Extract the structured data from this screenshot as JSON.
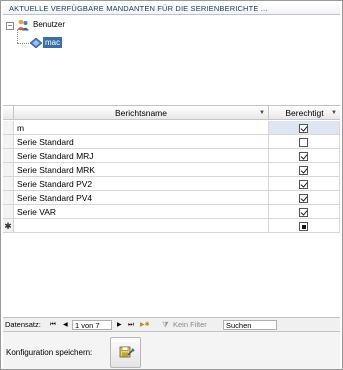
{
  "window": {
    "title": "AKTUELLE VERFÜGBARE MANDANTEN FÜR DIE SERIENBERICHTE ..."
  },
  "tree": {
    "root_label": "Benutzer",
    "root_expander": "⊟",
    "child_label": "mac"
  },
  "grid": {
    "columns": [
      {
        "label": "Berichtsname"
      },
      {
        "label": "Berechtigt"
      }
    ],
    "rows": [
      {
        "name": "m",
        "checked": true
      },
      {
        "name": "Serie Standard",
        "checked": false
      },
      {
        "name": "Serie Standard MRJ",
        "checked": true
      },
      {
        "name": "Serie Standard MRK",
        "checked": true
      },
      {
        "name": "Serie Standard PV2",
        "checked": true
      },
      {
        "name": "Serie Standard PV4",
        "checked": true
      },
      {
        "name": "Serie VAR",
        "checked": true
      }
    ],
    "new_row_marker": "✱"
  },
  "navigator": {
    "label": "Datensatz:",
    "first": "⏮",
    "prev": "◀",
    "position": "1 von 7",
    "next": "▶",
    "last": "⏭",
    "new": "▶✱",
    "filter_icon": "⧩",
    "filter_label": "Kein Filter",
    "search_label": "Suchen"
  },
  "footer": {
    "save_label": "Konfiguration speichern:"
  }
}
